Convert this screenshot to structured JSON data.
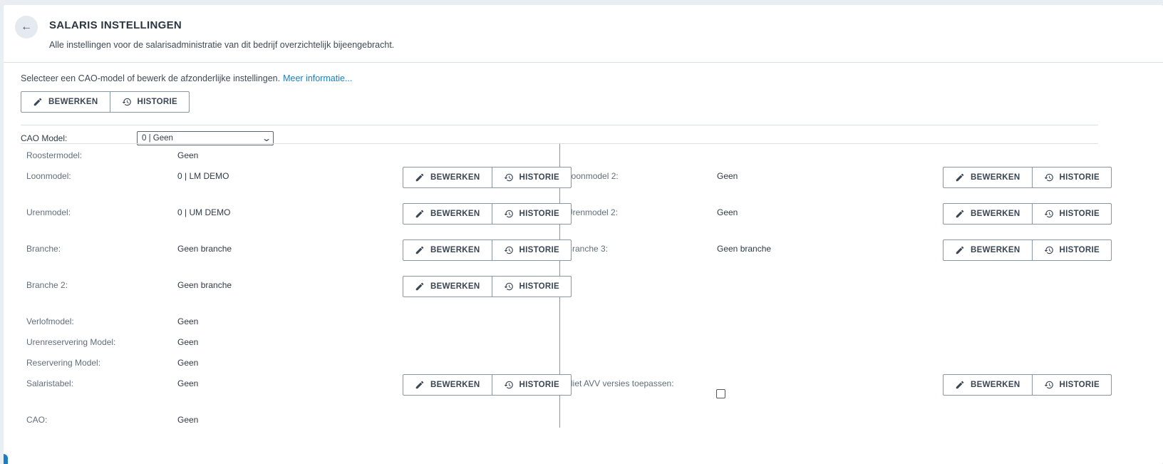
{
  "header": {
    "back_icon": "arrow-left-icon",
    "title": "SALARIS INSTELLINGEN",
    "subtitle": "Alle instellingen voor de salarisadministratie van dit bedrijf overzichtelijk bijeengebracht."
  },
  "intro": {
    "text": "Selecteer een CAO-model of bewerk de afzonderlijke instellingen.",
    "link": "Meer informatie..."
  },
  "buttons": {
    "edit": "BEWERKEN",
    "history": "HISTORIE",
    "edit_icon": "pencil-icon",
    "history_icon": "history-icon"
  },
  "cao_model": {
    "label": "CAO Model:",
    "selected": "0 | Geen"
  },
  "left_rows": [
    {
      "label": "Roostermodel:",
      "value": "Geen"
    },
    {
      "label": "Loonmodel:",
      "value": "0 | LM DEMO"
    },
    {
      "label": "Urenmodel:",
      "value": "0 | UM DEMO"
    },
    {
      "label": "Branche:",
      "value": "Geen branche"
    },
    {
      "label": "Branche 2:",
      "value": "Geen branche"
    },
    {
      "label": "Verlofmodel:",
      "value": "Geen"
    },
    {
      "label": "Urenreservering Model:",
      "value": "Geen"
    },
    {
      "label": "Reservering Model:",
      "value": "Geen"
    },
    {
      "label": "Salaristabel:",
      "value": "Geen"
    },
    {
      "label": "CAO:",
      "value": "Geen"
    }
  ],
  "right_rows": [
    {
      "label": "Loonmodel 2:",
      "value": "Geen"
    },
    {
      "label": "Urenmodel 2:",
      "value": "Geen"
    },
    {
      "label": "Branche 3:",
      "value": "Geen branche"
    },
    {
      "label": "Niet AVV versies toepassen:",
      "checked": false
    }
  ]
}
